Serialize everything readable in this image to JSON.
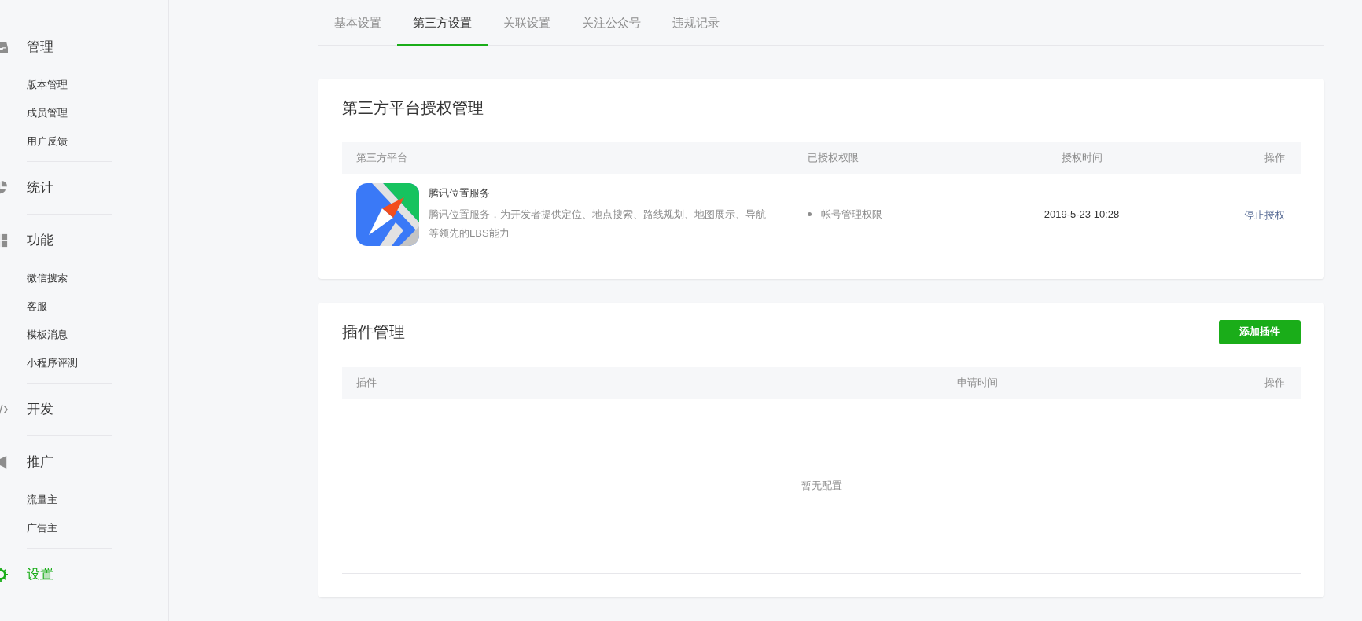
{
  "sidebar": {
    "sections": [
      {
        "label": "管理",
        "selected": false,
        "items": [
          {
            "label": "版本管理"
          },
          {
            "label": "成员管理"
          },
          {
            "label": "用户反馈"
          }
        ]
      },
      {
        "label": "统计",
        "selected": false
      },
      {
        "label": "功能",
        "selected": false,
        "items": [
          {
            "label": "微信搜索"
          },
          {
            "label": "客服"
          },
          {
            "label": "模板消息"
          },
          {
            "label": "小程序评测"
          }
        ]
      },
      {
        "label": "开发",
        "selected": false
      },
      {
        "label": "推广",
        "selected": false,
        "items": [
          {
            "label": "流量主"
          },
          {
            "label": "广告主"
          }
        ]
      },
      {
        "label": "设置",
        "selected": true
      }
    ]
  },
  "tabs": [
    {
      "label": "基本设置",
      "selected": false
    },
    {
      "label": "第三方设置",
      "selected": true
    },
    {
      "label": "关联设置",
      "selected": false
    },
    {
      "label": "关注公众号",
      "selected": false
    },
    {
      "label": "违规记录",
      "selected": false
    }
  ],
  "authorization": {
    "title": "第三方平台授权管理",
    "columns": [
      "第三方平台",
      "已授权权限",
      "授权时间",
      "操作"
    ],
    "rows": [
      {
        "name": "腾讯位置服务",
        "description": "腾讯位置服务，为开发者提供定位、地点搜索、路线规划、地图展示、导航等领先的LBS能力",
        "permissions": [
          "帐号管理权限"
        ],
        "time": "2019-5-23 10:28",
        "action": "停止授权"
      }
    ]
  },
  "plugins": {
    "title": "插件管理",
    "add_button": "添加插件",
    "columns": [
      "插件",
      "申请时间",
      "操作"
    ],
    "empty_text": "暂无配置"
  }
}
